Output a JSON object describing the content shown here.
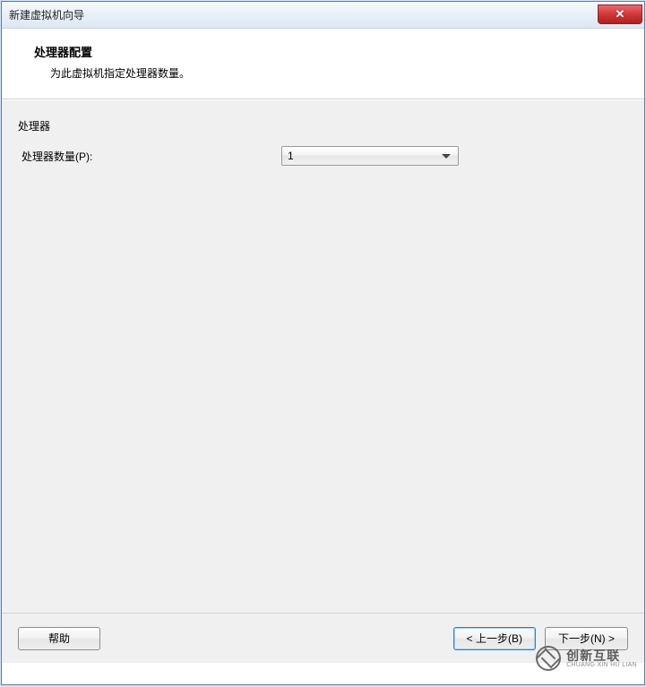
{
  "window": {
    "title": "新建虚拟机向导"
  },
  "header": {
    "title": "处理器配置",
    "subtitle": "为此虚拟机指定处理器数量。"
  },
  "form": {
    "group_label": "处理器",
    "processor_count_label": "处理器数量(P):",
    "processor_count_value": "1"
  },
  "footer": {
    "help_label": "帮助",
    "back_label": "< 上一步(B)",
    "next_label": "下一步(N) >"
  },
  "brand": {
    "cn": "创新互联",
    "en": "CHUANG XIN HU LIAN"
  }
}
